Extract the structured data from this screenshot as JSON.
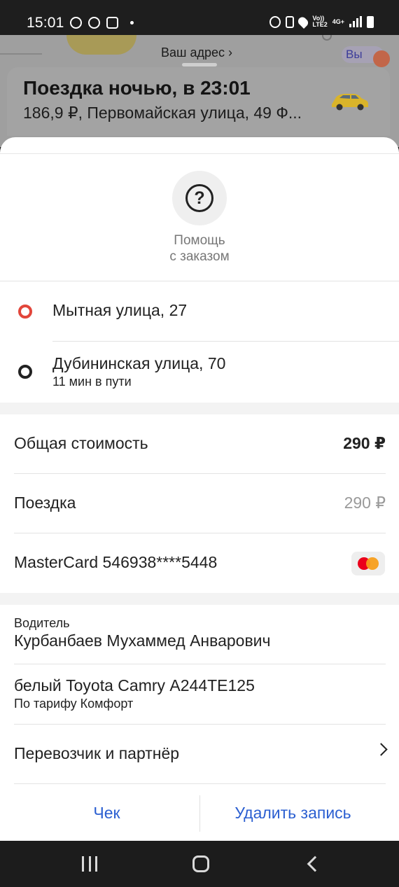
{
  "status_bar": {
    "time": "15:01",
    "network_top": "Vo))",
    "network_bottom": "LTE2",
    "network_type": "4G+",
    "left_icons": [
      "notification-icon",
      "whatsapp-icon",
      "instagram-icon"
    ],
    "right_icons": [
      "alarm-icon",
      "battery-saver-icon",
      "location-icon",
      "signal-icon",
      "battery-icon"
    ]
  },
  "map": {
    "address_link": "Ваш адрес ›",
    "pill_text": "Вы"
  },
  "order_card": {
    "title": "Поездка ночью, в 23:01",
    "subtitle": "186,9 ₽, Первомайская улица, 49 Ф..."
  },
  "help": {
    "label_line1": "Помощь",
    "label_line2": "с заказом"
  },
  "route": {
    "from": "Мытная улица, 27",
    "to": "Дубининская улица, 70",
    "duration": "11 мин в пути"
  },
  "cost": {
    "total_label": "Общая стоимость",
    "total_value": "290 ₽",
    "ride_label": "Поездка",
    "ride_value": "290 ₽",
    "payment_label": "MasterCard 546938****5448"
  },
  "driver": {
    "caption": "Водитель",
    "name": "Курбанбаев Мухаммед Анварович",
    "car": "белый Toyota Camry А244ТЕ125",
    "tariff": "По тарифу Комфорт",
    "carrier_label": "Перевозчик и партнёр"
  },
  "actions": {
    "receipt": "Чек",
    "delete": "Удалить запись"
  },
  "colors": {
    "accent_blue": "#2b5fd1",
    "from_point": "#e2463b",
    "mastercard_red": "#eb001b",
    "mastercard_orange": "#f79e1b"
  }
}
